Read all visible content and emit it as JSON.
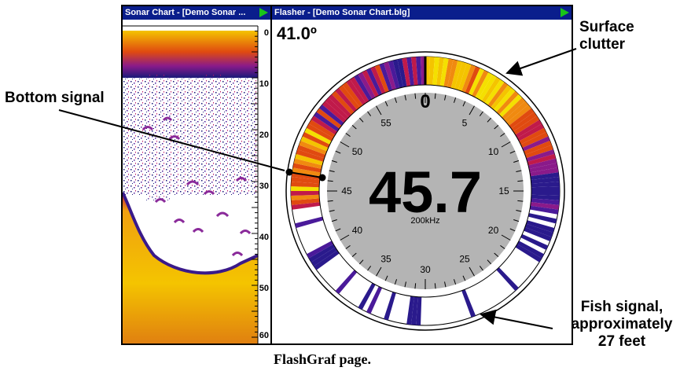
{
  "sonar_window": {
    "title": "Sonar Chart - [Demo Sonar ...",
    "depth_scale": [
      "0",
      "10",
      "20",
      "30",
      "40",
      "50",
      "60"
    ]
  },
  "flasher_window": {
    "title": "Flasher - [Demo Sonar Chart.blg]",
    "temperature": "41.0º",
    "depth_reading": "45.7",
    "frequency": "200kHz",
    "dial_labels": [
      "0",
      "5",
      "10",
      "15",
      "20",
      "25",
      "30",
      "35",
      "40",
      "45",
      "50",
      "55"
    ]
  },
  "callouts": {
    "surface_clutter": [
      "Surface",
      "clutter"
    ],
    "bottom_signal": "Bottom signal",
    "fish_signal": [
      "Fish signal,",
      "approximately",
      "27 feet"
    ]
  },
  "caption": "FlashGraf page.",
  "colors": {
    "titlebar": "#0a1e8c",
    "play_button": "#19c419",
    "dial_face": "#b4b4b4",
    "bottom_echo": "#f4b400",
    "weak_echo": "#2a1a8c"
  }
}
